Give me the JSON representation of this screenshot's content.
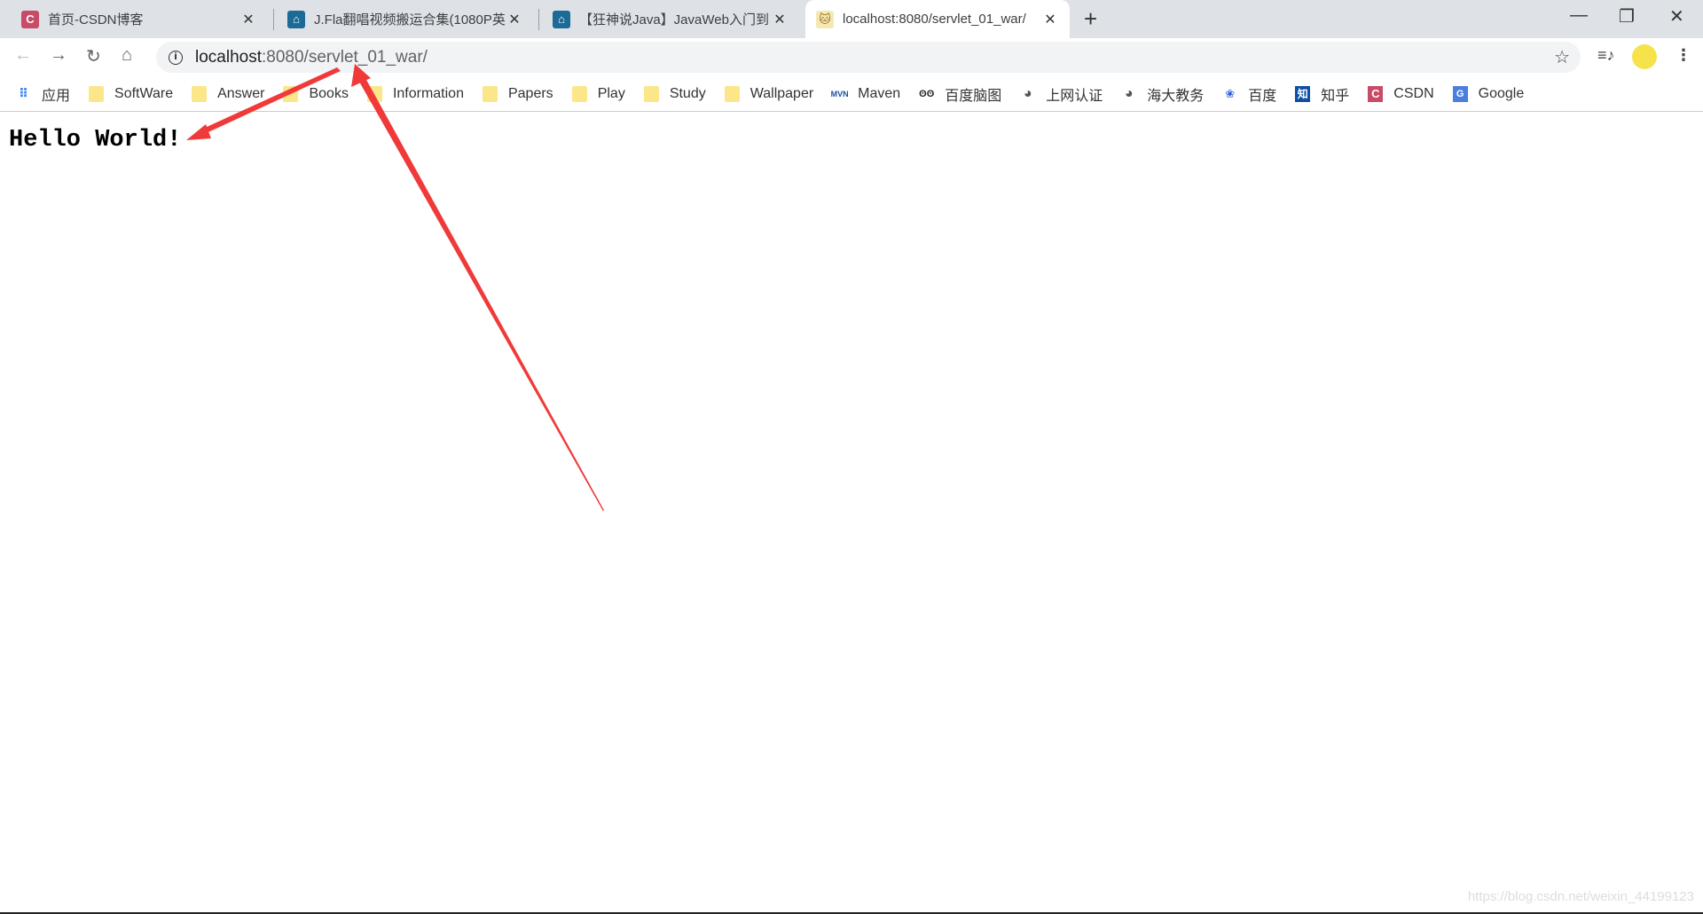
{
  "tabs": [
    {
      "title": "首页-CSDN博客",
      "icon": "csdn-icon",
      "icon_color": "#c94b67"
    },
    {
      "title": "J.Fla翻唱视频搬运合集(1080P英",
      "icon": "bilibili-icon",
      "icon_color": "#1c6b96"
    },
    {
      "title": "【狂神说Java】JavaWeb入门到",
      "icon": "bilibili-icon",
      "icon_color": "#1c6b96"
    },
    {
      "title": "localhost:8080/servlet_01_war/",
      "icon": "tomcat-icon",
      "active": true
    }
  ],
  "address": {
    "host": "localhost",
    "path": ":8080/servlet_01_war/"
  },
  "bookmarks": [
    {
      "label": "应用",
      "icon": "apps-icon"
    },
    {
      "label": "SoftWare",
      "icon": "folder-icon"
    },
    {
      "label": "Answer",
      "icon": "folder-icon"
    },
    {
      "label": "Books",
      "icon": "folder-icon"
    },
    {
      "label": "Information",
      "icon": "folder-icon"
    },
    {
      "label": "Papers",
      "icon": "folder-icon"
    },
    {
      "label": "Play",
      "icon": "folder-icon"
    },
    {
      "label": "Study",
      "icon": "folder-icon"
    },
    {
      "label": "Wallpaper",
      "icon": "folder-icon"
    },
    {
      "label": "Maven",
      "icon": "maven-icon",
      "glyph": "MVN"
    },
    {
      "label": "百度脑图",
      "icon": "owl-icon",
      "glyph": "ʘʘ"
    },
    {
      "label": "上网认证",
      "icon": "globe-icon",
      "glyph": "◕"
    },
    {
      "label": "海大教务",
      "icon": "globe-icon",
      "glyph": "◕"
    },
    {
      "label": "百度",
      "icon": "baidu-paw-icon",
      "glyph": "🐾"
    },
    {
      "label": "知乎",
      "icon": "zhihu-icon",
      "glyph": "知"
    },
    {
      "label": "CSDN",
      "icon": "csdn-icon",
      "glyph": "C"
    },
    {
      "label": "Google",
      "icon": "google-translate-icon",
      "glyph": "G"
    }
  ],
  "page": {
    "text": "Hello World!"
  },
  "watermark": "https://blog.csdn.net/weixin_44199123",
  "annotation_color": "#f03a3a"
}
